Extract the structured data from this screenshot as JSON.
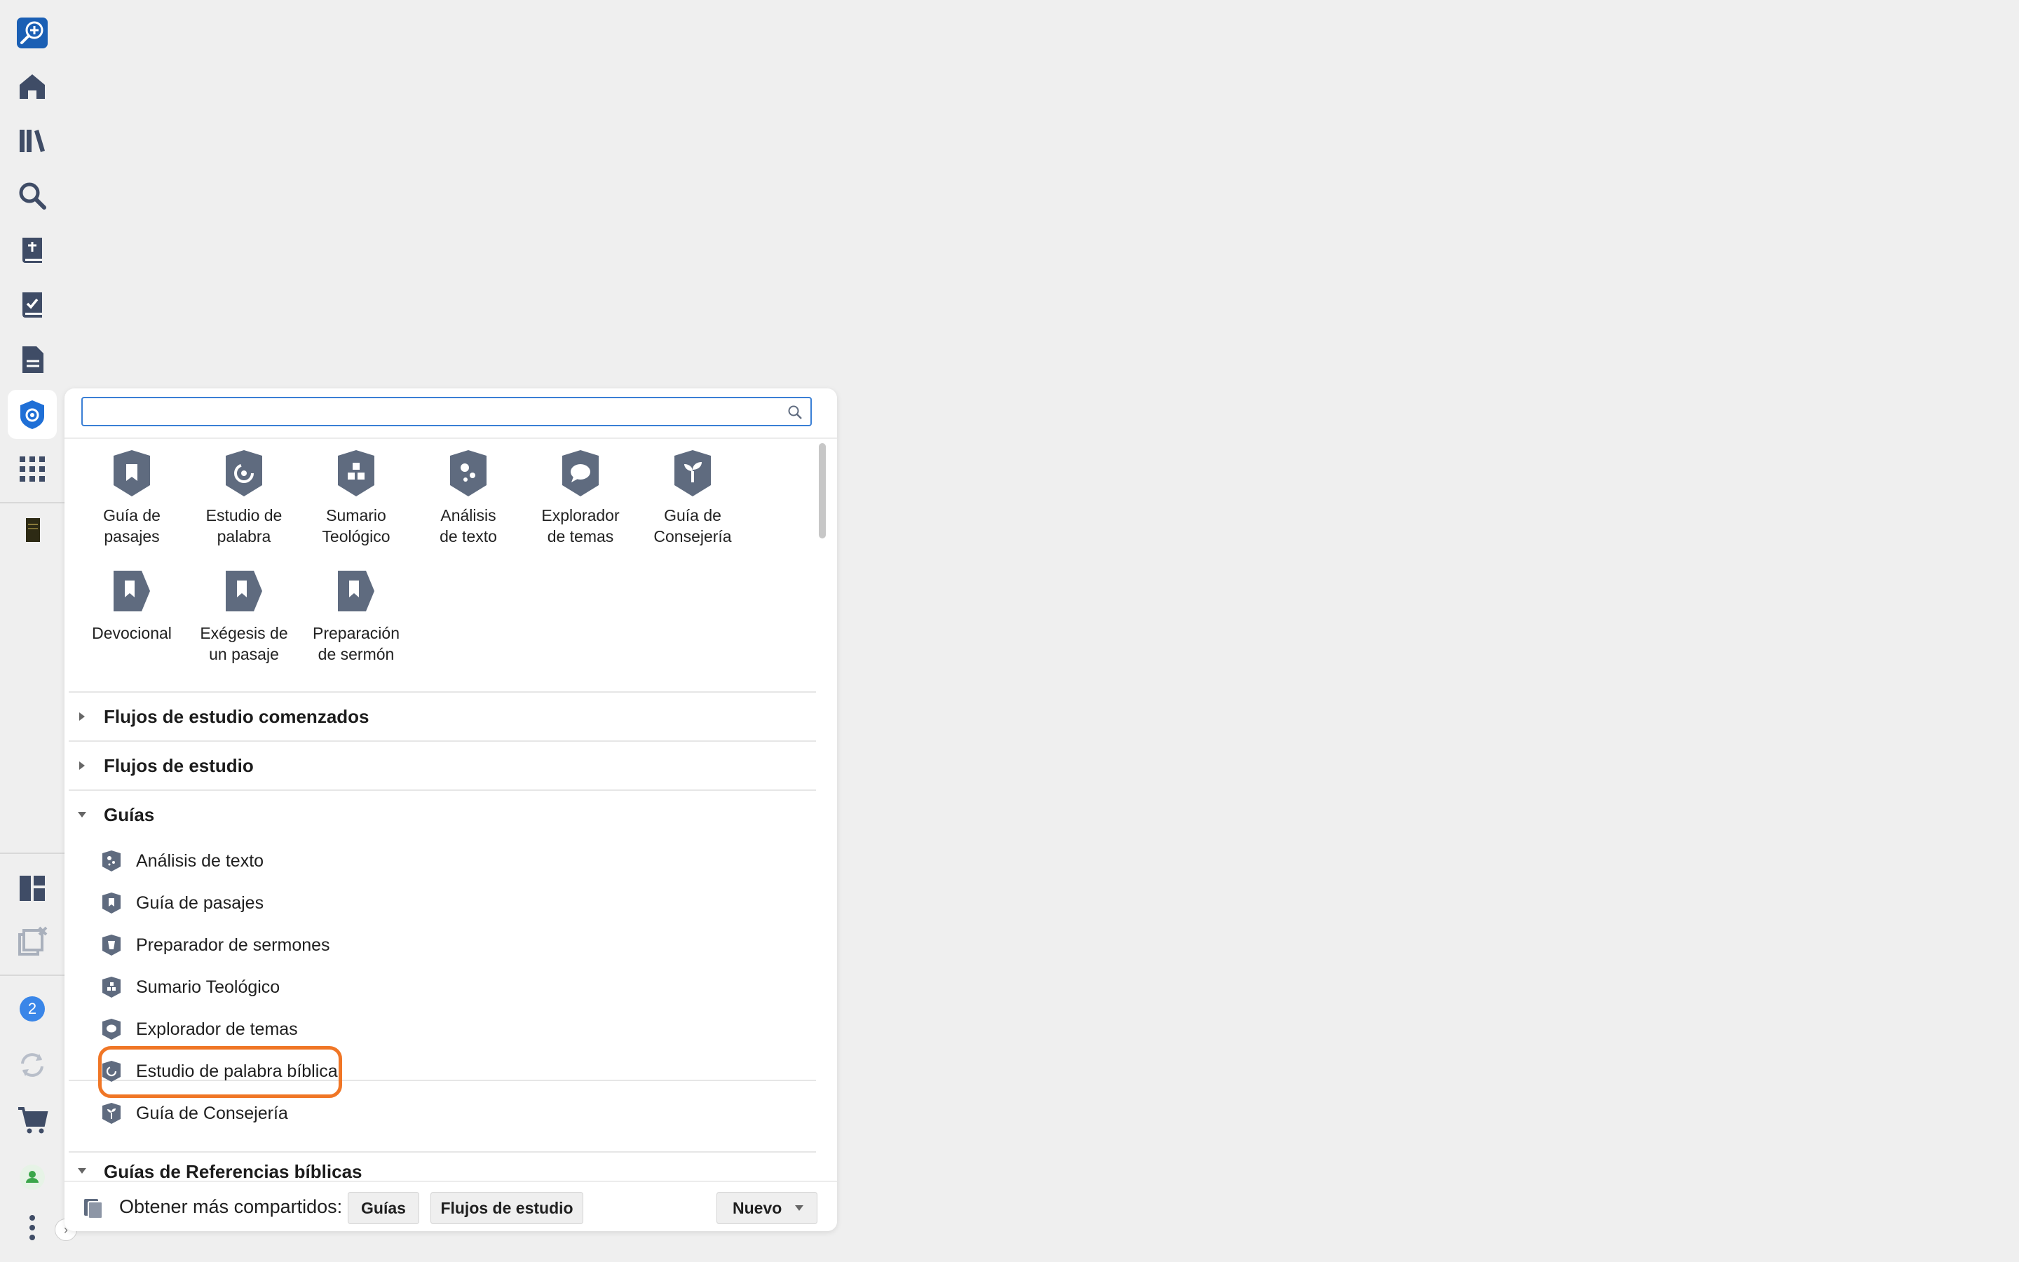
{
  "search": {
    "placeholder": "",
    "value": ""
  },
  "tiles": [
    {
      "name": "tile-guia-de-pasajes",
      "label": "Guía de\npasajes",
      "icon": "bookmark-shield-icon"
    },
    {
      "name": "tile-estudio-de-palabra",
      "label": "Estudio de\npalabra",
      "icon": "word-study-icon"
    },
    {
      "name": "tile-sumario-teologico",
      "label": "Sumario\nTeológico",
      "icon": "blocks-icon"
    },
    {
      "name": "tile-analisis-de-texto",
      "label": "Análisis\nde texto",
      "icon": "dots-icon"
    },
    {
      "name": "tile-explorador-de-temas",
      "label": "Explorador\nde temas",
      "icon": "speech-bubble-icon"
    },
    {
      "name": "tile-guia-de-consejeria",
      "label": "Guía de\nConsejería",
      "icon": "sprout-icon"
    },
    {
      "name": "tile-devocional",
      "label": "Devocional",
      "icon": "bookmark-tag-icon"
    },
    {
      "name": "tile-exegesis",
      "label": "Exégesis de\nun pasaje",
      "icon": "bookmark-tag-icon"
    },
    {
      "name": "tile-preparacion-sermon",
      "label": "Preparación\nde sermón",
      "icon": "bookmark-tag-icon"
    }
  ],
  "sections": {
    "started_workflows": "Flujos de estudio comenzados",
    "workflows": "Flujos de estudio",
    "guides": "Guías",
    "bible_ref_guides": "Guías de Referencias bíblicas"
  },
  "guides": [
    {
      "label": "Análisis de texto",
      "icon": "dots-icon"
    },
    {
      "label": "Guía de pasajes",
      "icon": "bookmark-shield-icon"
    },
    {
      "label": "Preparador de sermones",
      "icon": "sermon-icon"
    },
    {
      "label": "Sumario Teológico",
      "icon": "blocks-icon"
    },
    {
      "label": "Explorador de temas",
      "icon": "speech-bubble-icon"
    },
    {
      "label": "Estudio de palabra bíblica",
      "icon": "word-study-icon"
    },
    {
      "label": "Guía de Consejería",
      "icon": "sprout-icon"
    }
  ],
  "footer": {
    "label": "Obtener más compartidos:",
    "guides_button": "Guías",
    "workflows_button": "Flujos de estudio",
    "new_button": "Nuevo"
  },
  "rail": {
    "notification_count": "2",
    "icons": [
      "logos-search-icon",
      "home-icon",
      "library-icon",
      "search-icon",
      "bible-icon",
      "checklist-icon",
      "document-icon",
      "guides-icon",
      "apps-grid-icon",
      "book-thumbnail-icon",
      "layouts-icon",
      "close-panels-icon",
      "notifications-icon",
      "sync-icon",
      "cart-icon",
      "account-icon",
      "more-icon"
    ]
  },
  "colors": {
    "icon": "#5f6b7f",
    "accent": "#3a7fd5",
    "highlight": "#f07626",
    "rail_icon": "#3f4c66",
    "active_icon": "#1f6fd6"
  }
}
